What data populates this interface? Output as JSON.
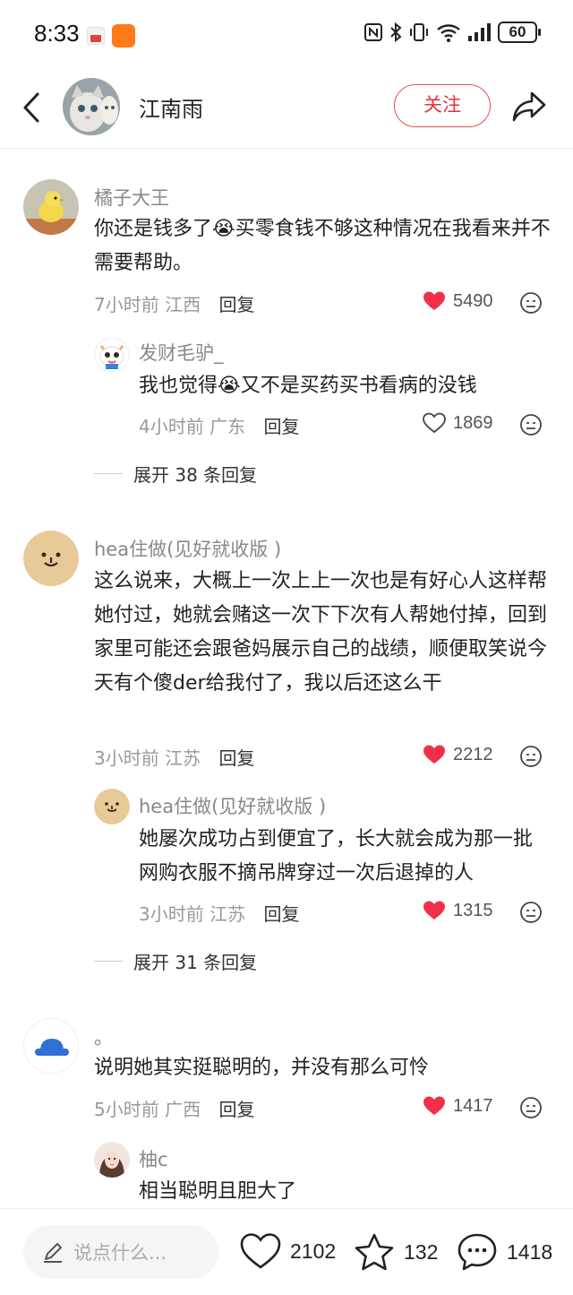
{
  "status_bar": {
    "time": "8:33",
    "battery": "60"
  },
  "header": {
    "username": "江南雨",
    "follow_label": "关注"
  },
  "comments": [
    {
      "username": "橘子大王",
      "text": "你还是钱多了😭买零食钱不够这种情况在我看来并不需要帮助。",
      "time": "7小时前",
      "location": "江西",
      "reply_label": "回复",
      "likes": "5490",
      "liked": true,
      "replies": [
        {
          "username": "发财毛驴_",
          "text": "我也觉得😭又不是买药买书看病的没钱",
          "time": "4小时前",
          "location": "广东",
          "reply_label": "回复",
          "likes": "1869",
          "liked": false
        }
      ],
      "expand_label": "展开 38 条回复"
    },
    {
      "username": "hea住做(见好就收版 )",
      "text": "这么说来，大概上一次上上一次也是有好心人这样帮她付过，她就会赌这一次下下次有人帮她付掉，回到家里可能还会跟爸妈展示自己的战绩，顺便取笑说今天有个傻der给我付了，我以后还这么干",
      "time": "3小时前",
      "location": "江苏",
      "reply_label": "回复",
      "likes": "2212",
      "liked": true,
      "replies": [
        {
          "username": "hea住做(见好就收版 )",
          "text": "她屡次成功占到便宜了，长大就会成为那一批网购衣服不摘吊牌穿过一次后退掉的人",
          "time": "3小时前",
          "location": "江苏",
          "reply_label": "回复",
          "likes": "1315",
          "liked": true
        }
      ],
      "expand_label": "展开 31 条回复"
    },
    {
      "username": "。",
      "text": "说明她其实挺聪明的，并没有那么可怜",
      "time": "5小时前",
      "location": "广西",
      "reply_label": "回复",
      "likes": "1417",
      "liked": true,
      "replies": [
        {
          "username": "柚c",
          "text": "相当聪明且胆大了"
        }
      ]
    }
  ],
  "bottom_bar": {
    "input_placeholder": "说点什么...",
    "likes": "2102",
    "favorites": "132",
    "comments": "1418"
  },
  "colors": {
    "accent_red": "#e63040",
    "heart_red": "#f0304a",
    "muted_text": "#999999"
  },
  "icons": [
    "back-arrow-icon",
    "share-icon",
    "heart-icon",
    "dislike-face-icon",
    "pencil-icon",
    "star-icon",
    "comment-bubble-icon",
    "nfc-icon",
    "bluetooth-icon",
    "vibrate-icon",
    "wifi-icon",
    "signal-icon"
  ]
}
